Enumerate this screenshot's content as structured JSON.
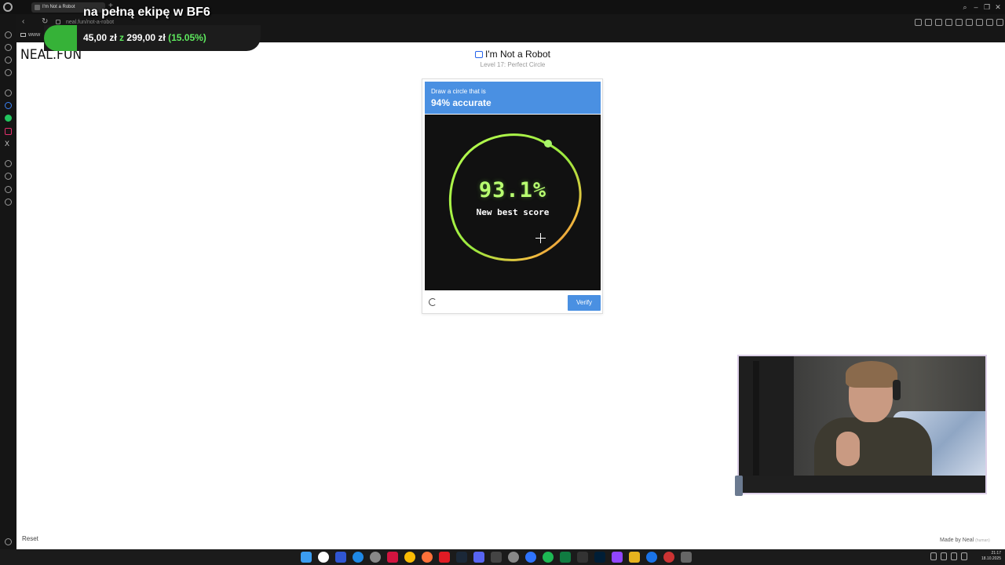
{
  "browser": {
    "tab_title": "I'm Not a Robot",
    "new_tab_symbol": "+",
    "url": "neal.fun/not-a-robot",
    "bookmark_label": "www",
    "window_controls": [
      "⌕",
      "–",
      "❐",
      "✕"
    ]
  },
  "overlay": {
    "title": "na pełną ekipę w BF6",
    "amount": "45,00 zł",
    "connector": "z",
    "target": "299,00 zł",
    "percent": "(15.05%)",
    "brand_color": "#36b238"
  },
  "page": {
    "logo": "NEAL.FUN",
    "title": "I'm Not a Robot",
    "level": "Level 17: Perfect Circle"
  },
  "captcha": {
    "instruction": "Draw a circle that is",
    "target": "94% accurate",
    "score": "93.1%",
    "message": "New best score",
    "verify_label": "Verify",
    "header_color": "#4a90e2",
    "score_color": "#b8ff70"
  },
  "footer": {
    "reset_label": "Reset",
    "made_by": "Made by Neal",
    "human_tag": "(human)"
  },
  "taskbar": {
    "time": "21:17",
    "date": "18.10.2025",
    "icons": [
      "windows-start-icon",
      "app-icon",
      "app-icon",
      "app-icon",
      "app-icon",
      "opera-gx-icon",
      "chrome-icon",
      "firefox-icon",
      "app-icon",
      "steam-icon",
      "discord-icon",
      "app-icon",
      "app-icon",
      "app-icon",
      "messenger-icon",
      "spotify-icon",
      "excel-icon",
      "capcut-icon",
      "photoshop-icon",
      "twitch-icon",
      "app-icon",
      "app-icon",
      "app-icon",
      "app-icon"
    ]
  }
}
